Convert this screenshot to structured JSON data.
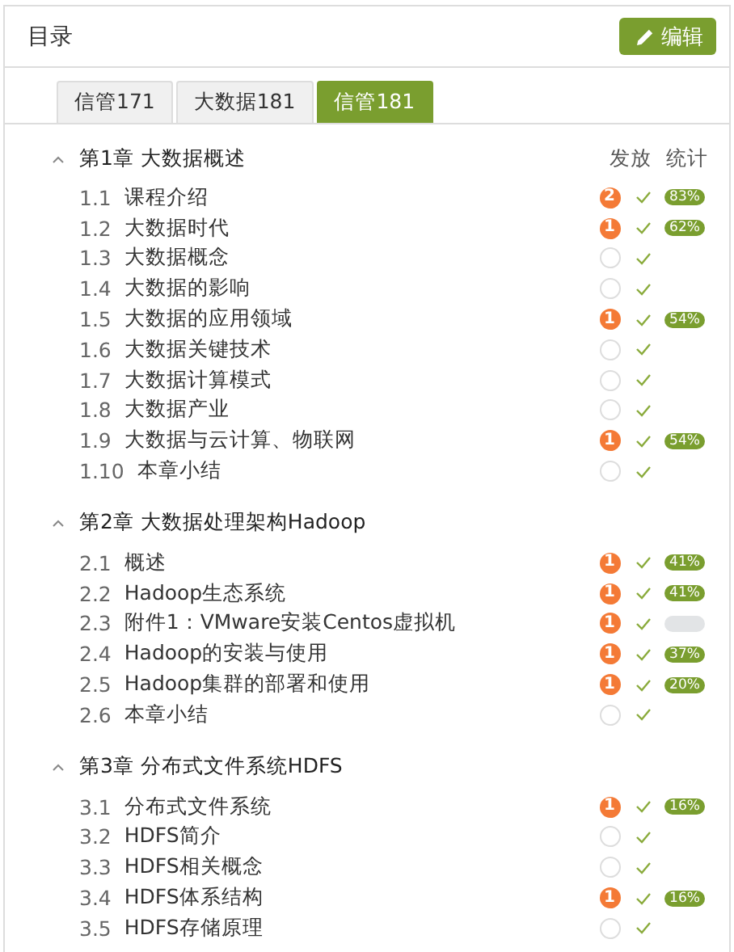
{
  "panel": {
    "title": "目录",
    "edit_button": "编辑"
  },
  "tabs": [
    {
      "label": "信管171",
      "selected": false
    },
    {
      "label": "大数据181",
      "selected": false
    },
    {
      "label": "信管181",
      "selected": true
    }
  ],
  "columns": [
    "发放",
    "统计"
  ],
  "chapters": [
    {
      "title": "第1章 大数据概述",
      "expanded": true,
      "items": [
        {
          "index": "1.1",
          "title": "课程介绍",
          "badge": "2",
          "released": true,
          "stat": {
            "kind": "pill",
            "label": "83%"
          }
        },
        {
          "index": "1.2",
          "title": "大数据时代",
          "badge": "1",
          "released": true,
          "stat": {
            "kind": "pill",
            "label": "62%"
          }
        },
        {
          "index": "1.3",
          "title": "大数据概念",
          "released": true
        },
        {
          "index": "1.4",
          "title": "大数据的影响",
          "released": true
        },
        {
          "index": "1.5",
          "title": "大数据的应用领域",
          "badge": "1",
          "released": true,
          "stat": {
            "kind": "pill",
            "label": "54%"
          }
        },
        {
          "index": "1.6",
          "title": "大数据关键技术",
          "released": true
        },
        {
          "index": "1.7",
          "title": "大数据计算模式",
          "released": true
        },
        {
          "index": "1.8",
          "title": "大数据产业",
          "released": true
        },
        {
          "index": "1.9",
          "title": "大数据与云计算、物联网",
          "badge": "1",
          "released": true,
          "stat": {
            "kind": "pill",
            "label": "54%"
          }
        },
        {
          "index": "1.10",
          "title": "本章小结",
          "released": true
        }
      ]
    },
    {
      "title": "第2章 大数据处理架构Hadoop",
      "expanded": true,
      "items": [
        {
          "index": "2.1",
          "title": "概述",
          "badge": "1",
          "released": true,
          "stat": {
            "kind": "pill",
            "label": "41%"
          }
        },
        {
          "index": "2.2",
          "title": "Hadoop生态系统",
          "badge": "1",
          "released": true,
          "stat": {
            "kind": "pill",
            "label": "41%"
          }
        },
        {
          "index": "2.3",
          "title": "附件1：VMware安装Centos虚拟机",
          "badge": "1",
          "released": true,
          "stat": {
            "kind": "empty"
          }
        },
        {
          "index": "2.4",
          "title": "Hadoop的安装与使用",
          "badge": "1",
          "released": true,
          "stat": {
            "kind": "pill",
            "label": "37%"
          }
        },
        {
          "index": "2.5",
          "title": "Hadoop集群的部署和使用",
          "badge": "1",
          "released": true,
          "stat": {
            "kind": "pill",
            "label": "20%"
          }
        },
        {
          "index": "2.6",
          "title": "本章小结",
          "released": true
        }
      ]
    },
    {
      "title": "第3章 分布式文件系统HDFS",
      "expanded": true,
      "items": [
        {
          "index": "3.1",
          "title": "分布式文件系统",
          "badge": "1",
          "released": true,
          "stat": {
            "kind": "pill",
            "label": "16%"
          }
        },
        {
          "index": "3.2",
          "title": "HDFS简介",
          "released": true
        },
        {
          "index": "3.3",
          "title": "HDFS相关概念",
          "released": true
        },
        {
          "index": "3.4",
          "title": "HDFS体系结构",
          "badge": "1",
          "released": true,
          "stat": {
            "kind": "pill",
            "label": "16%"
          }
        },
        {
          "index": "3.5",
          "title": "HDFS存储原理",
          "released": true
        }
      ]
    }
  ]
}
